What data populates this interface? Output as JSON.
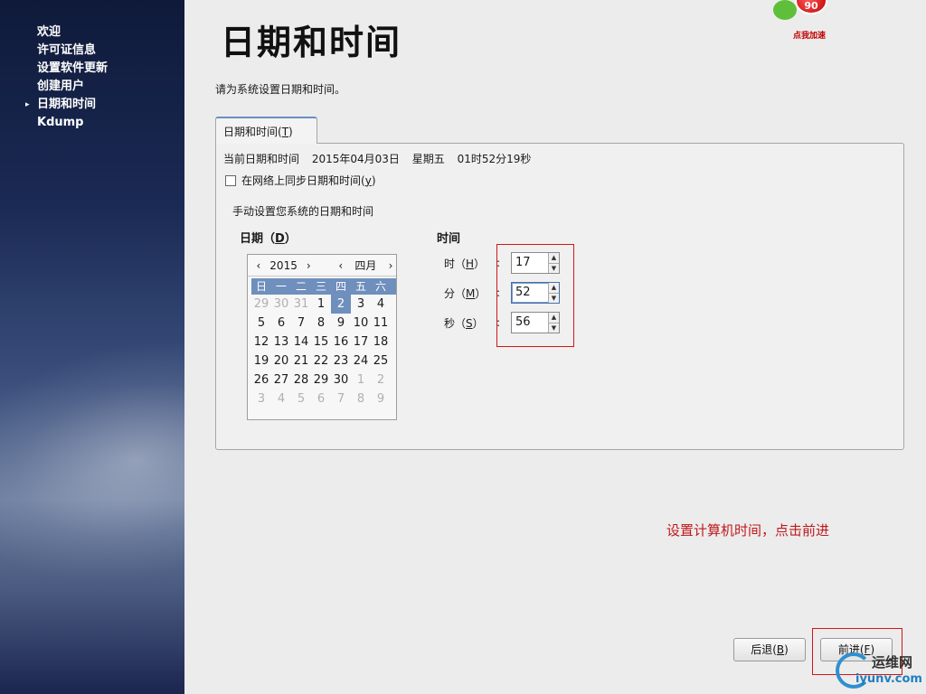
{
  "sidebar": {
    "items": [
      {
        "label": "欢迎",
        "current": false
      },
      {
        "label": "许可证信息",
        "current": false
      },
      {
        "label": "设置软件更新",
        "current": false
      },
      {
        "label": "创建用户",
        "current": false
      },
      {
        "label": "日期和时间",
        "current": true
      },
      {
        "label": "Kdump",
        "current": false
      }
    ],
    "current_marker": "▸"
  },
  "header": {
    "title": "日期和时间",
    "instruction": "请为系统设置日期和时间。"
  },
  "badge": {
    "number": "90",
    "caption": "点我加速"
  },
  "tab": {
    "label": "日期和时间",
    "mnemonic": "T"
  },
  "current": {
    "label": "当前日期和时间",
    "date": "2015年04月03日",
    "weekday": "星期五",
    "time": "01时52分19秒"
  },
  "sync": {
    "label": "在网络上同步日期和时间",
    "mnemonic": "y",
    "checked": false
  },
  "manual_label": "手动设置您系统的日期和时间",
  "date_section": {
    "label": "日期",
    "mnemonic": "D"
  },
  "calendar": {
    "year": "2015",
    "month": "四月",
    "prev": "‹",
    "next": "›",
    "weekdays": [
      "日",
      "一",
      "二",
      "三",
      "四",
      "五",
      "六"
    ],
    "weeks": [
      [
        "29",
        "30",
        "31",
        "1",
        "2",
        "3",
        "4"
      ],
      [
        "5",
        "6",
        "7",
        "8",
        "9",
        "10",
        "11"
      ],
      [
        "12",
        "13",
        "14",
        "15",
        "16",
        "17",
        "18"
      ],
      [
        "19",
        "20",
        "21",
        "22",
        "23",
        "24",
        "25"
      ],
      [
        "26",
        "27",
        "28",
        "29",
        "30",
        "1",
        "2"
      ],
      [
        "3",
        "4",
        "5",
        "6",
        "7",
        "8",
        "9"
      ]
    ],
    "selected_day": "2"
  },
  "time_section": {
    "label": "时间",
    "hour_label": "时",
    "hour_mnemonic": "H",
    "hour": "17",
    "minute_label": "分",
    "minute_mnemonic": "M",
    "minute": "52",
    "second_label": "秒",
    "second_mnemonic": "S",
    "second": "56",
    "colon": ":"
  },
  "annotation": "设置计算机时间，点击前进",
  "buttons": {
    "back_label": "后退",
    "back_mnemonic": "B",
    "next_label": "前进",
    "next_mnemonic": "F"
  },
  "watermark": {
    "cn": "运维网",
    "en": "iyunv.com"
  },
  "colors": {
    "sidebar_bg": "#1b2a55",
    "selection": "#6f8fbd",
    "annotation_red": "#c0181a"
  }
}
